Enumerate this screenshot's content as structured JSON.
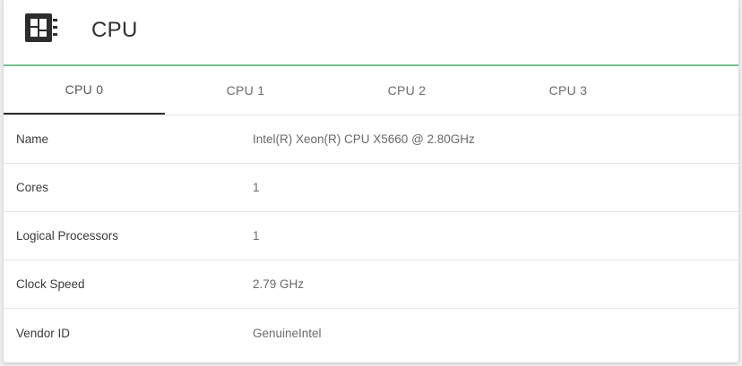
{
  "header": {
    "title": "CPU",
    "icon": "cpu-chip-icon",
    "accent_color": "#79c08f"
  },
  "tabs": [
    {
      "label": "CPU 0",
      "active": true
    },
    {
      "label": "CPU 1",
      "active": false
    },
    {
      "label": "CPU 2",
      "active": false
    },
    {
      "label": "CPU 3",
      "active": false
    }
  ],
  "details": [
    {
      "label": "Name",
      "value": "Intel(R) Xeon(R) CPU X5660 @ 2.80GHz"
    },
    {
      "label": "Cores",
      "value": "1"
    },
    {
      "label": "Logical Processors",
      "value": "1"
    },
    {
      "label": "Clock Speed",
      "value": "2.79 GHz"
    },
    {
      "label": "Vendor ID",
      "value": "GenuineIntel"
    }
  ]
}
